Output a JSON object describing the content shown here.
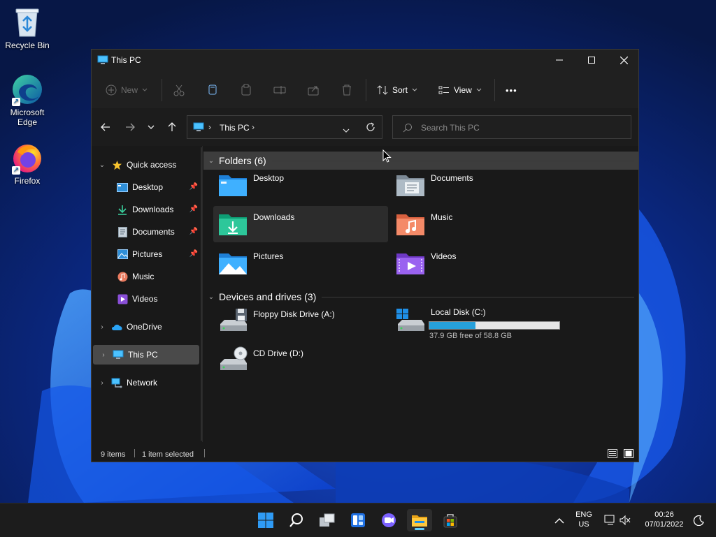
{
  "desktop": {
    "icons": [
      {
        "label": "Recycle Bin"
      },
      {
        "label_line1": "Microsoft",
        "label_line2": "Edge"
      },
      {
        "label": "Firefox"
      }
    ]
  },
  "window": {
    "title": "This PC",
    "toolbar": {
      "new_label": "New",
      "sort_label": "Sort",
      "view_label": "View",
      "more_label": "•••"
    },
    "address": {
      "text": "This PC"
    },
    "search": {
      "placeholder": "Search This PC",
      "value": ""
    },
    "sidebar": {
      "quick_access": "Quick access",
      "pinned": [
        {
          "label": "Desktop"
        },
        {
          "label": "Downloads"
        },
        {
          "label": "Documents"
        },
        {
          "label": "Pictures"
        },
        {
          "label": "Music"
        },
        {
          "label": "Videos"
        }
      ],
      "onedrive": "OneDrive",
      "this_pc": "This PC",
      "network": "Network"
    },
    "folders_header": "Folders (6)",
    "folders": [
      {
        "name": "Desktop"
      },
      {
        "name": "Documents"
      },
      {
        "name": "Downloads"
      },
      {
        "name": "Music"
      },
      {
        "name": "Pictures"
      },
      {
        "name": "Videos"
      }
    ],
    "devices_header": "Devices and drives (3)",
    "drives": [
      {
        "name": "Floppy Disk Drive (A:)"
      },
      {
        "name": "Local Disk (C:)",
        "free_text": "37.9 GB free of 58.8 GB",
        "used_fraction": 0.356
      },
      {
        "name": "CD Drive (D:)"
      }
    ],
    "status": {
      "items": "9 items",
      "selected": "1 item selected"
    }
  },
  "taskbar": {
    "language_line1": "ENG",
    "language_line2": "US",
    "time": "00:26",
    "date": "07/01/2022"
  },
  "colors": {
    "accent": "#60cdff",
    "drive_fill": "#26a0da",
    "window_bg": "#191919"
  }
}
